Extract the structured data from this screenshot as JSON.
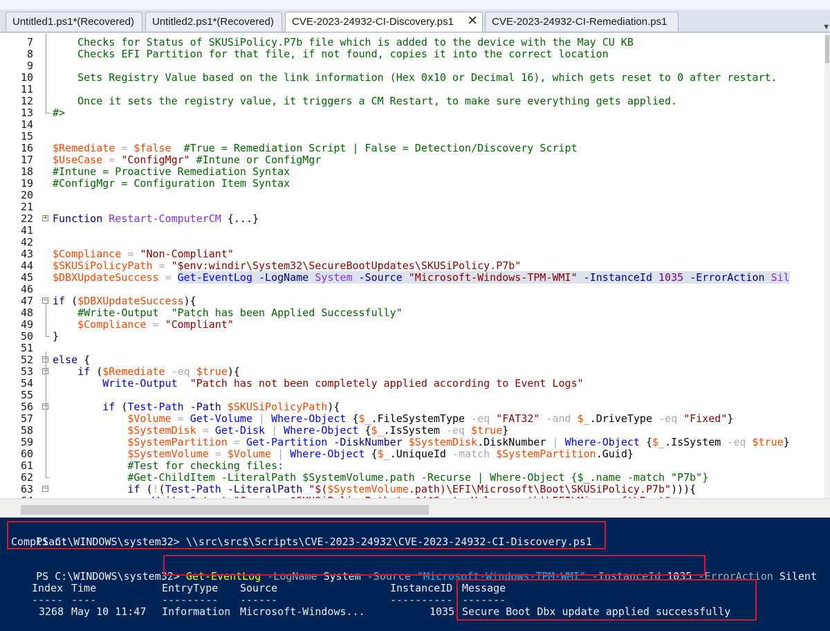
{
  "tabs": [
    {
      "label": "Untitled1.ps1*(Recovered)",
      "active": false
    },
    {
      "label": "Untitled2.ps1*(Recovered)",
      "active": false
    },
    {
      "label": "CVE-2023-24932-CI-Discovery.ps1",
      "active": true
    },
    {
      "label": "CVE-2023-24932-CI-Remediation.ps1",
      "active": false
    }
  ],
  "tab_close_glyph": "✕",
  "tab_dropdown_glyph": "▼",
  "editor_lines": [
    {
      "n": "7",
      "tokens": [
        [
          "cmtblk",
          "    Checks for Status of SKUSiPolicy.P7b file which is added to the device with the May CU KB"
        ]
      ]
    },
    {
      "n": "8",
      "tokens": [
        [
          "cmtblk",
          "    Checks EFI Partition for that file, if not found, copies it into the correct location"
        ]
      ]
    },
    {
      "n": "9",
      "tokens": []
    },
    {
      "n": "10",
      "tokens": [
        [
          "cmtblk",
          "    Sets Registry Value based on the link information (Hex 0x10 or Decimal 16), which gets reset to 0 after restart."
        ]
      ]
    },
    {
      "n": "11",
      "tokens": []
    },
    {
      "n": "12",
      "tokens": [
        [
          "cmtblk",
          "    Once it sets the registry value, it triggers a CM Restart, to make sure everything gets applied."
        ]
      ]
    },
    {
      "n": "13",
      "tokens": [
        [
          "cmtblk",
          "#>"
        ]
      ]
    },
    {
      "n": "14",
      "tokens": []
    },
    {
      "n": "15",
      "tokens": []
    },
    {
      "n": "16",
      "tokens": [
        [
          "var",
          "$Remediate"
        ],
        [
          "plain",
          " "
        ],
        [
          "op",
          "="
        ],
        [
          "plain",
          " "
        ],
        [
          "var",
          "$false"
        ],
        [
          "plain",
          "  "
        ],
        [
          "cmt",
          "#True = Remediation Script | False = Detection/Discovery Script"
        ]
      ]
    },
    {
      "n": "17",
      "tokens": [
        [
          "var",
          "$UseCase"
        ],
        [
          "plain",
          " "
        ],
        [
          "op",
          "="
        ],
        [
          "plain",
          " "
        ],
        [
          "str",
          "\"ConfigMgr\""
        ],
        [
          "plain",
          " "
        ],
        [
          "cmt",
          "#Intune or ConfigMgr"
        ]
      ]
    },
    {
      "n": "18",
      "tokens": [
        [
          "cmt",
          "#Intune = Proactive Remediation Syntax"
        ]
      ]
    },
    {
      "n": "19",
      "tokens": [
        [
          "cmt",
          "#ConfigMgr = Configuration Item Syntax"
        ]
      ]
    },
    {
      "n": "20",
      "tokens": []
    },
    {
      "n": "21",
      "tokens": []
    },
    {
      "n": "22",
      "tokens": [
        [
          "kw",
          "Function"
        ],
        [
          "plain",
          " "
        ],
        [
          "fname",
          "Restart-ComputerCM"
        ],
        [
          "plain",
          " {...}"
        ]
      ]
    },
    {
      "n": "41",
      "tokens": []
    },
    {
      "n": "42",
      "tokens": []
    },
    {
      "n": "43",
      "tokens": [
        [
          "var",
          "$Compliance"
        ],
        [
          "plain",
          " "
        ],
        [
          "op",
          "="
        ],
        [
          "plain",
          " "
        ],
        [
          "str",
          "\"Non-Compliant\""
        ]
      ]
    },
    {
      "n": "44",
      "tokens": [
        [
          "var",
          "$SKUSiPolicyPath"
        ],
        [
          "plain",
          " "
        ],
        [
          "op",
          "="
        ],
        [
          "plain",
          " "
        ],
        [
          "str",
          "\"$env:windir\\System32\\SecureBootUpdates\\SKUSiPolicy.P7b\""
        ]
      ]
    },
    {
      "n": "45",
      "tokens": [
        [
          "var",
          "$DBXUpdateSuccess"
        ],
        [
          "plain",
          " "
        ],
        [
          "op",
          "="
        ],
        [
          "plain",
          " "
        ],
        [
          "cmd",
          "Get-EventLog"
        ],
        [
          "plain",
          " "
        ],
        [
          "param",
          "-LogName"
        ],
        [
          "plain",
          " "
        ],
        [
          "arg",
          "System"
        ],
        [
          "plain",
          " "
        ],
        [
          "param",
          "-Source"
        ],
        [
          "plain",
          " "
        ],
        [
          "str",
          "\"Microsoft-Windows-TPM-WMI\""
        ],
        [
          "plain",
          " "
        ],
        [
          "param",
          "-InstanceId"
        ],
        [
          "plain",
          " "
        ],
        [
          "num",
          "1035"
        ],
        [
          "plain",
          " "
        ],
        [
          "param",
          "-ErrorAction"
        ],
        [
          "plain",
          " "
        ],
        [
          "arg",
          "Sil"
        ]
      ]
    },
    {
      "n": "46",
      "tokens": []
    },
    {
      "n": "47",
      "tokens": [
        [
          "kw",
          "if"
        ],
        [
          "plain",
          " ("
        ],
        [
          "var",
          "$DBXUpdateSuccess"
        ],
        [
          "plain",
          "){"
        ]
      ]
    },
    {
      "n": "48",
      "tokens": [
        [
          "plain",
          "    "
        ],
        [
          "cmt",
          "#Write-Output  \"Patch has been Applied Successfully\""
        ]
      ]
    },
    {
      "n": "49",
      "tokens": [
        [
          "plain",
          "    "
        ],
        [
          "var",
          "$Compliance"
        ],
        [
          "plain",
          " "
        ],
        [
          "op",
          "="
        ],
        [
          "plain",
          " "
        ],
        [
          "str",
          "\"Compliant\""
        ]
      ]
    },
    {
      "n": "50",
      "tokens": [
        [
          "plain",
          "}"
        ]
      ]
    },
    {
      "n": "51",
      "tokens": []
    },
    {
      "n": "52",
      "tokens": [
        [
          "kw",
          "else"
        ],
        [
          "plain",
          " {"
        ]
      ]
    },
    {
      "n": "53",
      "tokens": [
        [
          "plain",
          "    "
        ],
        [
          "kw",
          "if"
        ],
        [
          "plain",
          " ("
        ],
        [
          "var",
          "$Remediate"
        ],
        [
          "plain",
          " "
        ],
        [
          "op",
          "-eq"
        ],
        [
          "plain",
          " "
        ],
        [
          "var",
          "$true"
        ],
        [
          "plain",
          "){"
        ]
      ]
    },
    {
      "n": "54",
      "tokens": [
        [
          "plain",
          "        "
        ],
        [
          "cmd",
          "Write-Output"
        ],
        [
          "plain",
          "  "
        ],
        [
          "str",
          "\"Patch has not been completely applied according to Event Logs\""
        ]
      ]
    },
    {
      "n": "55",
      "tokens": []
    },
    {
      "n": "56",
      "tokens": [
        [
          "plain",
          "        "
        ],
        [
          "kw",
          "if"
        ],
        [
          "plain",
          " ("
        ],
        [
          "cmd",
          "Test-Path"
        ],
        [
          "plain",
          " "
        ],
        [
          "param",
          "-Path"
        ],
        [
          "plain",
          " "
        ],
        [
          "var",
          "$SKUSiPolicyPath"
        ],
        [
          "plain",
          "){"
        ]
      ]
    },
    {
      "n": "57",
      "tokens": [
        [
          "plain",
          "            "
        ],
        [
          "var",
          "$Volume"
        ],
        [
          "plain",
          " "
        ],
        [
          "op",
          "="
        ],
        [
          "plain",
          " "
        ],
        [
          "cmd",
          "Get-Volume"
        ],
        [
          "plain",
          " "
        ],
        [
          "op",
          "|"
        ],
        [
          "plain",
          " "
        ],
        [
          "cmd",
          "Where-Object"
        ],
        [
          "plain",
          " {"
        ],
        [
          "var",
          "$_"
        ],
        [
          "plain",
          "."
        ],
        [
          "plain",
          "FileSystemType "
        ],
        [
          "op",
          "-eq"
        ],
        [
          "plain",
          " "
        ],
        [
          "str",
          "\"FAT32\""
        ],
        [
          "plain",
          " "
        ],
        [
          "op",
          "-and"
        ],
        [
          "plain",
          " "
        ],
        [
          "var",
          "$_"
        ],
        [
          "plain",
          ".DriveType "
        ],
        [
          "op",
          "-eq"
        ],
        [
          "plain",
          " "
        ],
        [
          "str",
          "\"Fixed\""
        ],
        [
          "plain",
          "}"
        ]
      ]
    },
    {
      "n": "58",
      "tokens": [
        [
          "plain",
          "            "
        ],
        [
          "var",
          "$SystemDisk"
        ],
        [
          "plain",
          " "
        ],
        [
          "op",
          "="
        ],
        [
          "plain",
          " "
        ],
        [
          "cmd",
          "Get-Disk"
        ],
        [
          "plain",
          " "
        ],
        [
          "op",
          "|"
        ],
        [
          "plain",
          " "
        ],
        [
          "cmd",
          "Where-Object"
        ],
        [
          "plain",
          " {"
        ],
        [
          "var",
          "$_"
        ],
        [
          "plain",
          ".IsSystem "
        ],
        [
          "op",
          "-eq"
        ],
        [
          "plain",
          " "
        ],
        [
          "var",
          "$true"
        ],
        [
          "plain",
          "}"
        ]
      ]
    },
    {
      "n": "59",
      "tokens": [
        [
          "plain",
          "            "
        ],
        [
          "var",
          "$SystemPartition"
        ],
        [
          "plain",
          " "
        ],
        [
          "op",
          "="
        ],
        [
          "plain",
          " "
        ],
        [
          "cmd",
          "Get-Partition"
        ],
        [
          "plain",
          " "
        ],
        [
          "param",
          "-DiskNumber"
        ],
        [
          "plain",
          " "
        ],
        [
          "var",
          "$SystemDisk"
        ],
        [
          "plain",
          ".DiskNumber "
        ],
        [
          "op",
          "|"
        ],
        [
          "plain",
          " "
        ],
        [
          "cmd",
          "Where-Object"
        ],
        [
          "plain",
          " {"
        ],
        [
          "var",
          "$_"
        ],
        [
          "plain",
          ".IsSystem "
        ],
        [
          "op",
          "-eq"
        ],
        [
          "plain",
          " "
        ],
        [
          "var",
          "$true"
        ],
        [
          "plain",
          "}"
        ]
      ]
    },
    {
      "n": "60",
      "tokens": [
        [
          "plain",
          "            "
        ],
        [
          "var",
          "$SystemVolume"
        ],
        [
          "plain",
          " "
        ],
        [
          "op",
          "="
        ],
        [
          "plain",
          " "
        ],
        [
          "var",
          "$Volume"
        ],
        [
          "plain",
          " "
        ],
        [
          "op",
          "|"
        ],
        [
          "plain",
          " "
        ],
        [
          "cmd",
          "Where-Object"
        ],
        [
          "plain",
          " {"
        ],
        [
          "var",
          "$_"
        ],
        [
          "plain",
          ".UniqueId "
        ],
        [
          "op",
          "-match"
        ],
        [
          "plain",
          " "
        ],
        [
          "var",
          "$SystemPartition"
        ],
        [
          "plain",
          ".Guid}"
        ]
      ]
    },
    {
      "n": "61",
      "tokens": [
        [
          "plain",
          "            "
        ],
        [
          "cmt",
          "#Test for checking files:"
        ]
      ]
    },
    {
      "n": "62",
      "tokens": [
        [
          "plain",
          "            "
        ],
        [
          "cmt",
          "#Get-ChildItem -LiteralPath $SystemVolume.path -Recurse | Where-Object {$_.name -match \"P7b\"}"
        ]
      ]
    },
    {
      "n": "63",
      "tokens": [
        [
          "plain",
          "            "
        ],
        [
          "kw",
          "if"
        ],
        [
          "plain",
          " ("
        ],
        [
          "op",
          "!"
        ],
        [
          "plain",
          "("
        ],
        [
          "cmd",
          "Test-Path"
        ],
        [
          "plain",
          " "
        ],
        [
          "param",
          "-LiteralPath"
        ],
        [
          "plain",
          " "
        ],
        [
          "str",
          "\"$("
        ],
        [
          "var",
          "$SystemVolume"
        ],
        [
          "str",
          ".path)\\EFI\\Microsoft\\Boot\\SKUSiPolicy.P7b\""
        ],
        [
          "plain",
          "))){"
        ]
      ]
    },
    {
      "n": "64",
      "tokens": [
        [
          "plain",
          "                "
        ],
        [
          "cmd",
          "Write-Output"
        ],
        [
          "plain",
          " "
        ],
        [
          "str",
          "\"Copying $SKUSiPolicyPath to $($SystemVolume.path)\\EFI\\Microsoft\\Boot\""
        ]
      ]
    }
  ],
  "console": {
    "line1_prompt": "PS C:\\WINDOWS\\system32> ",
    "line1_cmd": "\\\\src\\src$\\Scripts\\CVE-2023-24932\\CVE-2023-24932-CI-Discovery.ps1",
    "line2": "Compliant",
    "line3_prompt": "PS C:\\WINDOWS\\system32> ",
    "line3_cmd": "Get-EventLog",
    "line3_p1": " -LogName ",
    "line3_a1": "System",
    "line3_p2": " -Source ",
    "line3_a2": "\"Microsoft-Windows-TPM-WMI\"",
    "line3_p3": " -InstanceId ",
    "line3_a3": "1035",
    "line3_p4": " -ErrorAction ",
    "line3_a4": "Silent",
    "table_headers": [
      "Index",
      "Time",
      "EntryType",
      "Source",
      "InstanceID",
      "Message"
    ],
    "table_dashes": [
      "-----",
      "----",
      "---------",
      "------",
      "----------",
      "-------"
    ],
    "table_row": [
      "3268",
      "May 10 11:47",
      "Information",
      "Microsoft-Windows...",
      "1035",
      "Secure Boot Dbx update applied successfully"
    ]
  },
  "colors": {
    "console_bg": "#012456",
    "highlight_box": "#d0192b",
    "comment": "#006400",
    "variable": "#ff4500",
    "string": "#8b0000",
    "cmdlet": "#0000ff",
    "keyword": "#00008b"
  }
}
